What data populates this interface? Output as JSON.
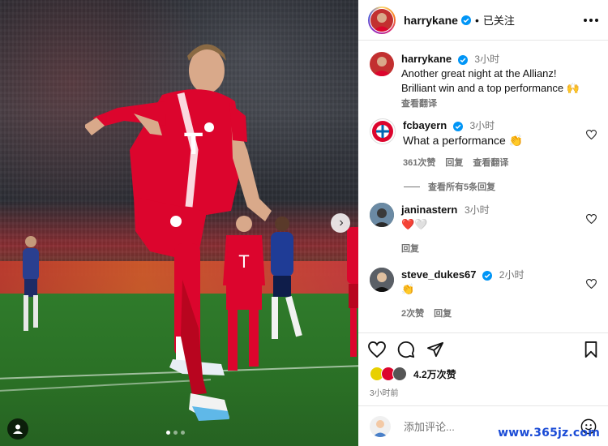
{
  "post": {
    "author": "harrykane",
    "follow_status": "已关注",
    "caption_time": "3小时",
    "caption_line1": "Another great night at the Allianz!",
    "caption_line2": "Brilliant win and a top performance 🙌",
    "translate": "查看翻译"
  },
  "comments": [
    {
      "user": "fcbayern",
      "time": "3小时",
      "text": "What a performance 👏",
      "likes": "361次赞",
      "reply": "回复",
      "translate": "查看翻译"
    },
    {
      "user": "janinastern",
      "time": "3小时",
      "text": "❤️🤍",
      "reply": "回复"
    },
    {
      "user": "steve_dukes67",
      "time": "2小时",
      "text": "👏",
      "likes": "2次赞",
      "reply": "回复"
    }
  ],
  "view_replies": "查看所有5条回复",
  "likes_count": "4.2万次赞",
  "posted_ago": "3小时前",
  "add_comment_placeholder": "添加评论...",
  "watermark": "www.365jz.com",
  "icons": {
    "like": "heart-icon",
    "comment": "comment-icon",
    "share": "send-icon",
    "save": "bookmark-icon",
    "next": "chevron-right-icon",
    "more": "more-icon",
    "emoji": "emoji-icon"
  },
  "colors": {
    "bayern_red": "#dc052d",
    "verified_blue": "#0095f6",
    "heart_red": "#ed4956"
  }
}
